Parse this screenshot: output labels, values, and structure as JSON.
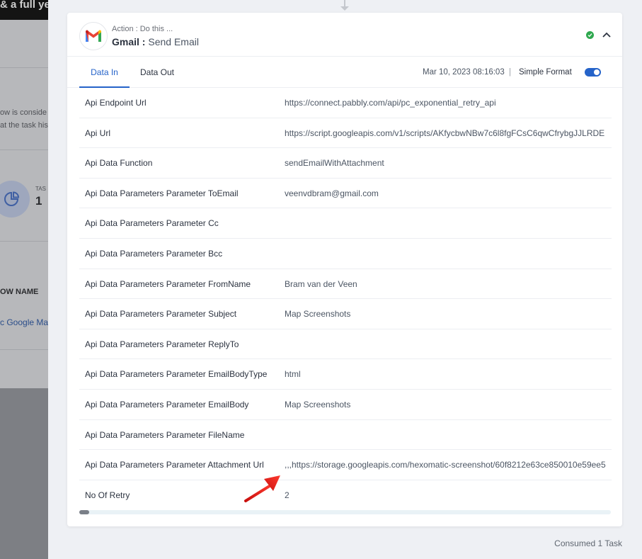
{
  "background": {
    "topbar_text": "& a full yea",
    "text_lines": [
      "ow is conside",
      "at the task his"
    ],
    "stat_label": "TAS",
    "stat_value": "1",
    "column_header": "OW NAME",
    "link_text": "c Google Ma"
  },
  "card": {
    "action_label": "Action : Do this ...",
    "app_name": "Gmail :",
    "event_name": "Send Email",
    "status_icon": "check-circle-icon",
    "collapse_icon": "chevron-up-icon"
  },
  "tabs": {
    "data_in": "Data In",
    "data_out": "Data Out",
    "active": "Data In"
  },
  "meta": {
    "timestamp": "Mar 10, 2023 08:16:03",
    "separator": "|",
    "simple_format_label": "Simple Format",
    "simple_format_on": true
  },
  "rows": [
    {
      "key": "Api Endpoint Url",
      "value": "https://connect.pabbly.com/api/pc_exponential_retry_api"
    },
    {
      "key": "Api Url",
      "value": "https://script.googleapis.com/v1/scripts/AKfycbwNBw7c6l8fgFCsC6qwCfrybgJJLRDE"
    },
    {
      "key": "Api Data Function",
      "value": "sendEmailWithAttachment"
    },
    {
      "key": "Api Data Parameters Parameter ToEmail",
      "value": "veenvdbram@gmail.com"
    },
    {
      "key": "Api Data Parameters Parameter Cc",
      "value": ""
    },
    {
      "key": "Api Data Parameters Parameter Bcc",
      "value": ""
    },
    {
      "key": "Api Data Parameters Parameter FromName",
      "value": "Bram van der Veen"
    },
    {
      "key": "Api Data Parameters Parameter Subject",
      "value": "Map Screenshots"
    },
    {
      "key": "Api Data Parameters Parameter ReplyTo",
      "value": ""
    },
    {
      "key": "Api Data Parameters Parameter EmailBodyType",
      "value": "html"
    },
    {
      "key": "Api Data Parameters Parameter EmailBody",
      "value": "Map Screenshots"
    },
    {
      "key": "Api Data Parameters Parameter FileName",
      "value": ""
    },
    {
      "key": "Api Data Parameters Parameter Attachment Url",
      "value": ",,,https://storage.googleapis.com/hexomatic-screenshot/60f8212e63ce850010e59ee5"
    },
    {
      "key": "No Of Retry",
      "value": "2"
    }
  ],
  "footer": {
    "consumed": "Consumed 1 Task"
  },
  "colors": {
    "accent": "#2563c9",
    "success": "#2fa84f",
    "annotation_arrow": "#e3201b"
  }
}
